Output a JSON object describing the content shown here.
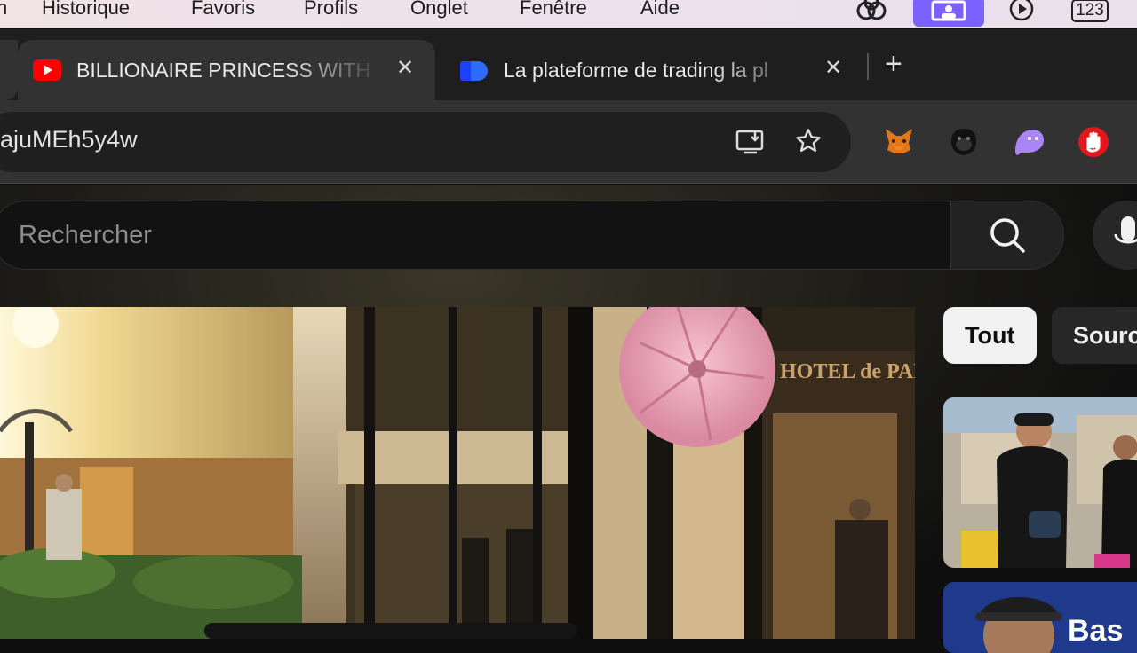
{
  "menubar": {
    "items": [
      "n",
      "Historique",
      "Favoris",
      "Profils",
      "Onglet",
      "Fenêtre",
      "Aide"
    ],
    "icons": [
      "creative-cloud-icon",
      "screen-share-icon",
      "play-circle-icon",
      "keyboard-123-icon"
    ],
    "badge_text": "123"
  },
  "tabs": [
    {
      "title": "BILLIONAIRE PRINCESS WITH",
      "favicon": "youtube-icon",
      "active": true
    },
    {
      "title": "La plateforme de trading la pl",
      "favicon": "trading-platform-icon",
      "active": false
    }
  ],
  "toolbar": {
    "url": "ajuMEh5y4w",
    "icons": [
      "install-app-icon",
      "bookmark-star-icon",
      "metamask-fox-icon",
      "gorilla-extension-icon",
      "ghost-extension-icon",
      "stop-hand-icon"
    ]
  },
  "youtube": {
    "search_placeholder": "Rechercher",
    "video_overlay_text": "HOTEL de PARIS",
    "chips": [
      "Tout",
      "Source"
    ],
    "thumb2_text": "Bas"
  },
  "colors": {
    "youtube_red": "#ff0000",
    "tab_bg_active": "#323232",
    "extension_purple": "#a985f5",
    "screen_share_purple": "#7b61ff"
  }
}
